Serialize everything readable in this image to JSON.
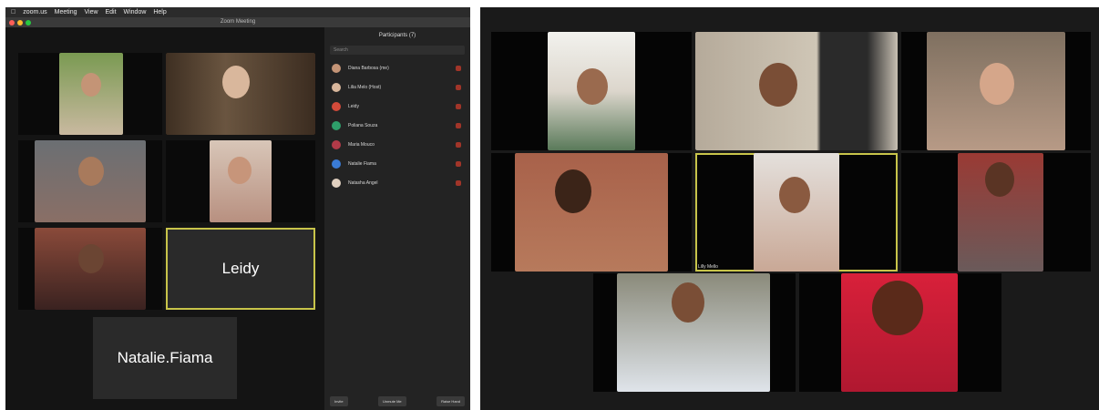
{
  "left_window": {
    "menu": [
      "zoom.us",
      "Meeting",
      "View",
      "Edit",
      "Window",
      "Help"
    ],
    "title": "Zoom Meeting",
    "name_tiles": [
      "Leidy",
      "Natalie.Fiama"
    ],
    "participants_title": "Participants (7)",
    "search_placeholder": "Search",
    "participants": [
      "Diana Barbosa (me)",
      "Lilia Melo (Host)",
      "Leidy",
      "Poliana Souza",
      "Maria Mouco",
      "Natalie Fiama",
      "Natasha Angel"
    ],
    "buttons": [
      "Invite",
      "Unmute Me",
      "Raise Hand"
    ]
  },
  "right_window": {
    "tile_label": "Lilly Mello"
  },
  "colors": {
    "active_speaker": "#c8c44a",
    "mic_muted": "#c0392b"
  }
}
